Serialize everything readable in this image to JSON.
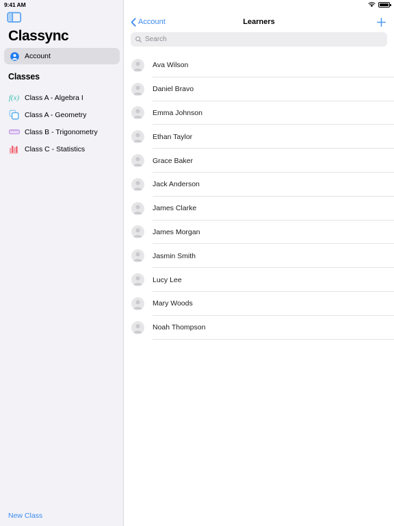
{
  "status_bar": {
    "time": "9:41 AM",
    "wifi_icon": "wifi-icon",
    "battery_icon": "battery-icon"
  },
  "sidebar": {
    "toggle_icon": "sidebar-toggle-icon",
    "app_title": "Classync",
    "account": {
      "label": "Account",
      "icon": "person-circle-icon",
      "selected": true
    },
    "section_title": "Classes",
    "classes": [
      {
        "label": "Class A - Algebra I",
        "icon": "function-fx-icon",
        "icon_color": "#3bbfad",
        "icon_text": "f(x)"
      },
      {
        "label": "Class A - Geometry",
        "icon": "shapes-squares-icon",
        "icon_color": "#7fc4f2"
      },
      {
        "label": "Class B - Trigonometry",
        "icon": "ruler-icon",
        "icon_color": "#c79fe8"
      },
      {
        "label": "Class C - Statistics",
        "icon": "bar-chart-icon",
        "icon_color": "#f1848c"
      }
    ],
    "new_class_label": "New Class",
    "accent_color": "#3b8aee",
    "background_color": "#f2f2f7"
  },
  "content": {
    "nav": {
      "back_label": "Account",
      "back_icon": "chevron-left-icon",
      "title": "Learners",
      "add_icon": "plus-icon",
      "accent_color": "#3b8aee"
    },
    "search": {
      "placeholder": "Search",
      "value": "",
      "icon": "search-icon"
    },
    "learners": [
      {
        "name": "Ava Wilson",
        "avatar": "person-avatar"
      },
      {
        "name": "Daniel Bravo",
        "avatar": "person-avatar"
      },
      {
        "name": "Emma Johnson",
        "avatar": "person-avatar"
      },
      {
        "name": "Ethan Taylor",
        "avatar": "person-avatar"
      },
      {
        "name": "Grace Baker",
        "avatar": "person-avatar"
      },
      {
        "name": "Jack Anderson",
        "avatar": "person-avatar"
      },
      {
        "name": "James Clarke",
        "avatar": "person-avatar"
      },
      {
        "name": "James Morgan",
        "avatar": "person-avatar"
      },
      {
        "name": "Jasmin Smith",
        "avatar": "person-avatar"
      },
      {
        "name": "Lucy Lee",
        "avatar": "person-avatar"
      },
      {
        "name": "Mary Woods",
        "avatar": "person-avatar"
      },
      {
        "name": "Noah Thompson",
        "avatar": "person-avatar"
      }
    ]
  }
}
